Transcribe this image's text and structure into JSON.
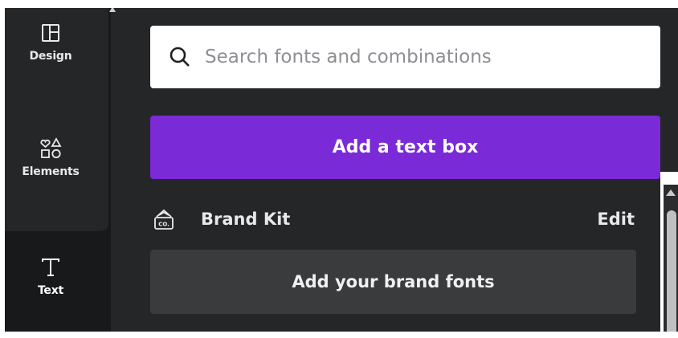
{
  "sidebar": {
    "items": [
      {
        "label": "Design",
        "icon": "layout-icon"
      },
      {
        "label": "Elements",
        "icon": "shapes-icon"
      },
      {
        "label": "Text",
        "icon": "text-icon"
      }
    ]
  },
  "search": {
    "placeholder": "Search fonts and combinations",
    "value": ""
  },
  "actions": {
    "add_text_box": "Add a text box"
  },
  "brand_kit": {
    "title": "Brand Kit",
    "edit_label": "Edit",
    "add_fonts_label": "Add your brand fonts",
    "icon_text": "CO."
  },
  "colors": {
    "accent": "#7b2ad8",
    "panel": "#252627",
    "rail": "#18191b"
  }
}
